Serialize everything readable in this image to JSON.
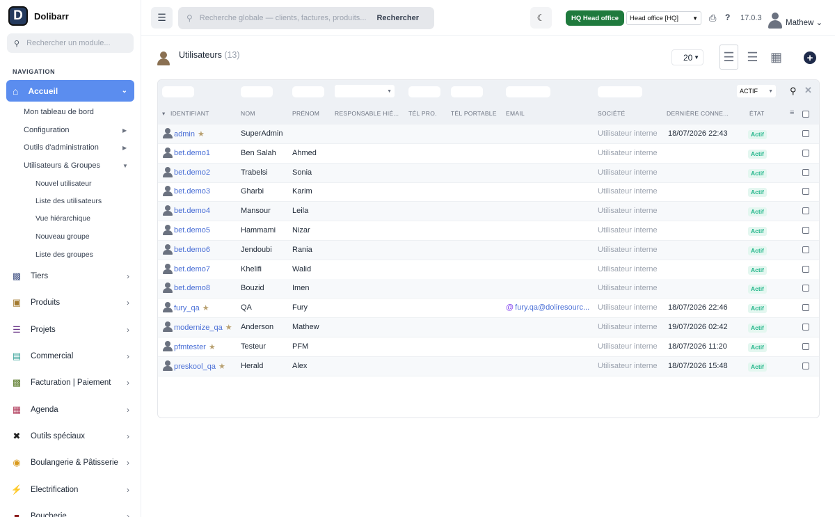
{
  "app": {
    "name": "Dolibarr",
    "logo_letter": "D"
  },
  "sidebar": {
    "search_placeholder": "Rechercher un module...",
    "nav_title": "NAVIGATION",
    "active": "Accueil",
    "subitems": [
      "Mon tableau de bord",
      "Configuration",
      "Outils d'administration",
      "Utilisateurs & Groupes"
    ],
    "subsubitems": [
      "Nouvel utilisateur",
      "Liste des utilisateurs",
      "Vue hiérarchique",
      "Nouveau groupe",
      "Liste des groupes"
    ],
    "modules": [
      {
        "label": "Tiers",
        "icon": "building-icon",
        "color": "#4b5b8a"
      },
      {
        "label": "Produits",
        "icon": "box-icon",
        "color": "#a2792e"
      },
      {
        "label": "Projets",
        "icon": "sitemap-icon",
        "color": "#6d3a8a"
      },
      {
        "label": "Commercial",
        "icon": "suitcase-icon",
        "color": "#3aa39a"
      },
      {
        "label": "Facturation | Paiement",
        "icon": "invoice-icon",
        "color": "#5a7a2a"
      },
      {
        "label": "Agenda",
        "icon": "calendar-icon",
        "color": "#b03a5a"
      },
      {
        "label": "Outils spéciaux",
        "icon": "tools-icon",
        "color": "#222"
      },
      {
        "label": "Boulangerie & Pâtisserie",
        "icon": "bread-icon",
        "color": "#d99a1e"
      },
      {
        "label": "Electrification",
        "icon": "bolt-icon",
        "color": "#e6b400"
      },
      {
        "label": "Boucherie",
        "icon": "meat-icon",
        "color": "#8a1a1a"
      }
    ]
  },
  "topbar": {
    "search_placeholder": "Recherche globale — clients, factures, produits...",
    "search_button": "Rechercher",
    "entity_badge": "HQ  Head office",
    "entity_select": "Head office [HQ]",
    "version": "17.0.3",
    "user": "Mathew"
  },
  "page": {
    "title": "Utilisateurs",
    "count": "(13)",
    "limit": "20",
    "filter_status": "ACTIF"
  },
  "columns": [
    "IDENTIFIANT",
    "NOM",
    "PRÉNOM",
    "RESPONSABLE HIÉ...",
    "TÉL PRO.",
    "TÉL PORTABLE",
    "EMAIL",
    "SOCIÉTÉ",
    "DERNIÈRE CONNE...",
    "ÉTAT"
  ],
  "rows": [
    {
      "login": "admin",
      "star": true,
      "nom": "SuperAdmin",
      "prenom": "",
      "email": "",
      "societe": "Utilisateur interne",
      "last": "18/07/2026 22:43",
      "etat": "Actif"
    },
    {
      "login": "bet.demo1",
      "star": false,
      "nom": "Ben Salah",
      "prenom": "Ahmed",
      "email": "",
      "societe": "Utilisateur interne",
      "last": "",
      "etat": "Actif"
    },
    {
      "login": "bet.demo2",
      "star": false,
      "nom": "Trabelsi",
      "prenom": "Sonia",
      "email": "",
      "societe": "Utilisateur interne",
      "last": "",
      "etat": "Actif"
    },
    {
      "login": "bet.demo3",
      "star": false,
      "nom": "Gharbi",
      "prenom": "Karim",
      "email": "",
      "societe": "Utilisateur interne",
      "last": "",
      "etat": "Actif"
    },
    {
      "login": "bet.demo4",
      "star": false,
      "nom": "Mansour",
      "prenom": "Leila",
      "email": "",
      "societe": "Utilisateur interne",
      "last": "",
      "etat": "Actif"
    },
    {
      "login": "bet.demo5",
      "star": false,
      "nom": "Hammami",
      "prenom": "Nizar",
      "email": "",
      "societe": "Utilisateur interne",
      "last": "",
      "etat": "Actif"
    },
    {
      "login": "bet.demo6",
      "star": false,
      "nom": "Jendoubi",
      "prenom": "Rania",
      "email": "",
      "societe": "Utilisateur interne",
      "last": "",
      "etat": "Actif"
    },
    {
      "login": "bet.demo7",
      "star": false,
      "nom": "Khelifi",
      "prenom": "Walid",
      "email": "",
      "societe": "Utilisateur interne",
      "last": "",
      "etat": "Actif"
    },
    {
      "login": "bet.demo8",
      "star": false,
      "nom": "Bouzid",
      "prenom": "Imen",
      "email": "",
      "societe": "Utilisateur interne",
      "last": "",
      "etat": "Actif"
    },
    {
      "login": "fury_qa",
      "star": true,
      "nom": "QA",
      "prenom": "Fury",
      "email": "fury.qa@doliresourc...",
      "societe": "Utilisateur interne",
      "last": "18/07/2026 22:46",
      "etat": "Actif"
    },
    {
      "login": "modernize_qa",
      "star": true,
      "nom": "Anderson",
      "prenom": "Mathew",
      "email": "",
      "societe": "Utilisateur interne",
      "last": "19/07/2026 02:42",
      "etat": "Actif"
    },
    {
      "login": "pfmtester",
      "star": true,
      "nom": "Testeur",
      "prenom": "PFM",
      "email": "",
      "societe": "Utilisateur interne",
      "last": "18/07/2026 11:20",
      "etat": "Actif"
    },
    {
      "login": "preskool_qa",
      "star": true,
      "nom": "Herald",
      "prenom": "Alex",
      "email": "",
      "societe": "Utilisateur interne",
      "last": "18/07/2026 15:48",
      "etat": "Actif"
    }
  ]
}
